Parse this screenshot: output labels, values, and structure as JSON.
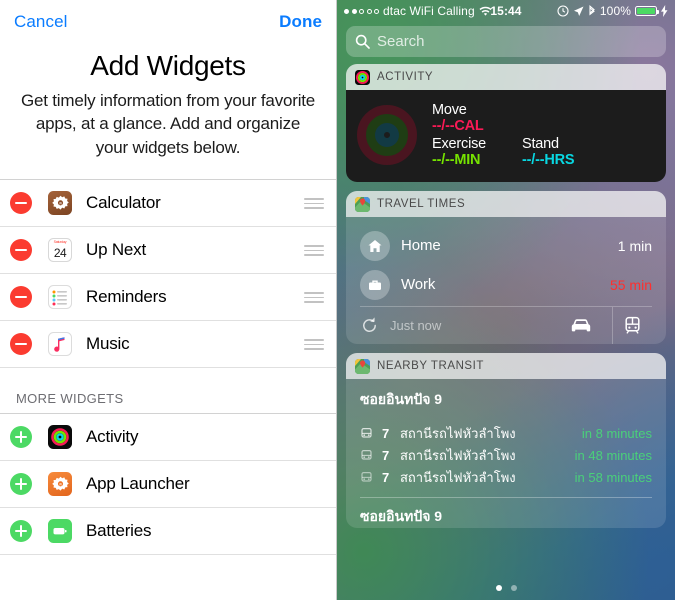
{
  "left_panel": {
    "cancel_label": "Cancel",
    "done_label": "Done",
    "title": "Add Widgets",
    "description": "Get timely information from your favorite apps, at a glance. Add and organize your widgets below.",
    "active_widgets": [
      {
        "label": "Calculator",
        "icon": "calculator-icon",
        "action": "remove"
      },
      {
        "label": "Up Next",
        "icon": "calendar-icon",
        "action": "remove",
        "day": "24",
        "weekday": "Saturday"
      },
      {
        "label": "Reminders",
        "icon": "reminders-icon",
        "action": "remove"
      },
      {
        "label": "Music",
        "icon": "music-icon",
        "action": "remove"
      }
    ],
    "more_section_label": "MORE WIDGETS",
    "more_widgets": [
      {
        "label": "Activity",
        "icon": "activity-icon",
        "action": "add"
      },
      {
        "label": "App Launcher",
        "icon": "app-launcher-icon",
        "action": "add"
      },
      {
        "label": "Batteries",
        "icon": "batteries-icon",
        "action": "add"
      }
    ]
  },
  "right_panel": {
    "status_bar": {
      "signal_dots_filled": 2,
      "signal_dots_total": 5,
      "carrier": "dtac WiFi Calling",
      "time": "15:44",
      "battery_percent": "100%",
      "icons": [
        "alarm-icon",
        "location-arrow-icon",
        "bluetooth-icon",
        "battery-icon",
        "charging-bolt-icon"
      ]
    },
    "search": {
      "placeholder": "Search"
    },
    "widgets": [
      {
        "id": "activity",
        "header": "ACTIVITY",
        "move_label": "Move",
        "move_value": "--/--CAL",
        "exercise_label": "Exercise",
        "exercise_value": "--/--MIN",
        "stand_label": "Stand",
        "stand_value": "--/--HRS",
        "colors": {
          "move": "#fa1a56",
          "exercise": "#76e300",
          "stand": "#08d8e2"
        }
      },
      {
        "id": "travel_times",
        "header": "TRAVEL TIMES",
        "rows": [
          {
            "name": "Home",
            "time": "1 min",
            "icon": "home-icon",
            "status": "normal"
          },
          {
            "name": "Work",
            "time": "55 min",
            "icon": "briefcase-icon",
            "status": "warn"
          }
        ],
        "updated": "Just now",
        "refresh_icon": "refresh-icon",
        "modes": [
          "car-icon",
          "train-icon"
        ]
      },
      {
        "id": "nearby_transit",
        "header": "NEARBY TRANSIT",
        "station": "ซอยอินทปัจ 9",
        "departures": [
          {
            "line": "7",
            "stop": "สถานีรถไฟหัวลำโพง",
            "eta": "in 8 minutes"
          },
          {
            "line": "7",
            "stop": "สถานีรถไฟหัวลำโพง",
            "eta": "in 48 minutes"
          },
          {
            "line": "7",
            "stop": "สถานีรถไฟหัวลำโพง",
            "eta": "in 58 minutes"
          }
        ],
        "next_station": "ซอยอินทปัจ 9"
      }
    ],
    "page_dots": {
      "count": 2,
      "active": 0
    }
  }
}
